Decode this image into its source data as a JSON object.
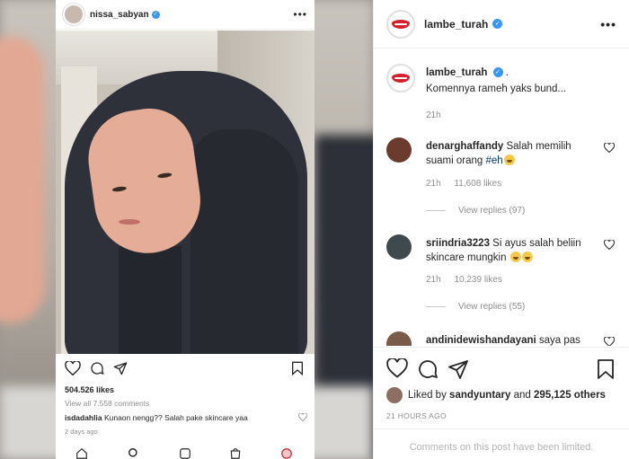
{
  "media": {
    "post_username": "nissa_sabyan",
    "likes": "504.526 likes",
    "view_all": "View all 7.558 comments",
    "comment_user": "isdadahlia",
    "comment_text": "Kunaon nengg?? Salah pake skincare yaa",
    "time_ago": "2 days ago"
  },
  "side": {
    "username": "lambe_turah",
    "caption": {
      "username": "lambe_turah",
      "suffix": ".",
      "text": "Komennya rameh yaks bund...",
      "time": "21h"
    },
    "comments": [
      {
        "username": "denarghaffandy",
        "text": "Salah memilih suami orang",
        "hashtag": "#eh",
        "time": "21h",
        "likes": "11,608 likes",
        "replies": "View replies (97)"
      },
      {
        "username": "sriindria3223",
        "text": "Si ayus salah beliin skincare mungkin",
        "time": "21h",
        "likes": "10,239 likes",
        "replies": "View replies (55)"
      },
      {
        "username": "andinidewishandayani",
        "text": "saya pas"
      }
    ],
    "liked_by_prefix": "Liked by",
    "liked_by_user": "sandyuntary",
    "liked_by_and": "and",
    "liked_by_others": "295,125 others",
    "timestamp": "21 HOURS AGO",
    "limited": "Comments on this post have been limited."
  },
  "colors": {
    "verified": "#3897f0",
    "lips": "#d4202a",
    "muted": "#8e8e8e"
  }
}
